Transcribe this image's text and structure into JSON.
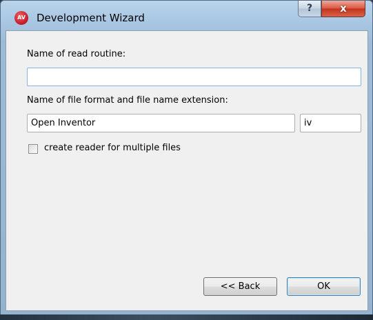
{
  "window": {
    "title": "Development Wizard",
    "app_icon_text": "AV",
    "help_symbol": "?",
    "close_symbol": "x"
  },
  "form": {
    "routine_label": "Name of read routine:",
    "routine_value": "",
    "format_label": "Name of file format and file name extension:",
    "format_value": "Open Inventor",
    "extension_value": "iv",
    "multi_checkbox_label": "create reader for multiple files",
    "multi_checkbox_checked": false
  },
  "buttons": {
    "back_label": "<< Back",
    "ok_label": "OK"
  },
  "colors": {
    "close_button": "#c7432c",
    "focus_border": "#7eb4ea",
    "default_button_border": "#3c7fb1"
  }
}
